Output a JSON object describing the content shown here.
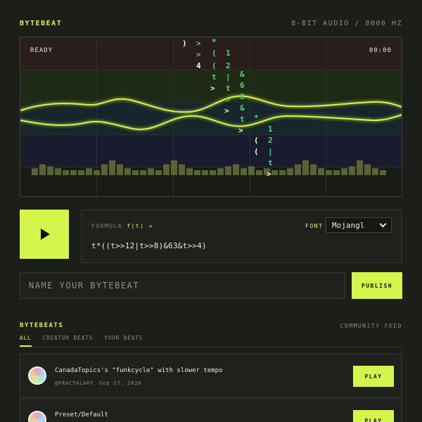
{
  "header": {
    "brand": "BYTEBEAT",
    "spec": "8-BIT AUDIO / 8000 HZ"
  },
  "visualizer": {
    "status": "READY",
    "time": "00:00",
    "bars": [
      0.35,
      0.55,
      0.45,
      0.35,
      0.25,
      0.25,
      0.25,
      0.35,
      0.25,
      0.55,
      0.75,
      0.55,
      0.35,
      0.25,
      0.25,
      0.35,
      0.25,
      0.55,
      0.75,
      0.55,
      0.35,
      0.25,
      0.25,
      0.25,
      0.35,
      0.45,
      0.55,
      0.35,
      0.45,
      0.25,
      0.35,
      0.25,
      0.25,
      0.35,
      0.55,
      0.75,
      0.55,
      0.35,
      0.25,
      0.25,
      0.35,
      0.45,
      0.75,
      0.55,
      0.35,
      0.25
    ],
    "glyphs": [
      {
        "ch": ")",
        "bright": true
      },
      {
        "ch": ">",
        "bright": false
      },
      {
        "ch": "*",
        "bright": false
      },
      {
        "ch": ">",
        "bright": false
      },
      {
        "ch": "(",
        "bright": false
      },
      {
        "ch": "1",
        "bright": false
      },
      {
        "ch": "4",
        "bright": true
      },
      {
        "ch": "(",
        "bright": false
      },
      {
        "ch": "2",
        "bright": false
      },
      {
        "ch": "t",
        "bright": false
      },
      {
        "ch": "|",
        "bright": false
      },
      {
        "ch": "&",
        "bright": false
      },
      {
        "ch": ">",
        "bright": true
      },
      {
        "ch": "t",
        "bright": false
      },
      {
        "ch": "6",
        "bright": false
      },
      {
        "ch": ">",
        "bright": false
      },
      {
        "ch": "3",
        "bright": false
      },
      {
        "ch": ">",
        "bright": true
      },
      {
        "ch": "&",
        "bright": false
      },
      {
        "ch": "t",
        "bright": false
      },
      {
        "ch": "*",
        "bright": false
      },
      {
        "ch": ">",
        "bright": true
      },
      {
        "ch": "1",
        "bright": false
      },
      {
        "ch": "(",
        "bright": true
      },
      {
        "ch": "2",
        "bright": false
      },
      {
        "ch": "(",
        "bright": true
      },
      {
        "ch": "|",
        "bright": false
      },
      {
        "ch": "t",
        "bright": false
      },
      {
        "ch": ">",
        "bright": true
      }
    ]
  },
  "controls": {
    "formula_label": "FORMULA",
    "fx_label": "f(t) =",
    "font_label": "FONT",
    "font_value": "Mojangl",
    "formula": "t*((t>>12|t>>8)&63&t>>4)"
  },
  "publish": {
    "placeholder": "NAME YOUR BYTEBEAT",
    "button": "PUBLISH"
  },
  "feed": {
    "title": "BYTEBEATS",
    "community": "COMMUNITY FEED",
    "tabs": [
      "ALL",
      "CREATOR BEATS",
      "YOUR BEATS"
    ],
    "items": [
      {
        "title": "CanadaTopics's \"funkcycle\" with slower tempo",
        "handle": "@FRACTALART",
        "date": "Sep 27, 2026",
        "play": "PLAY"
      },
      {
        "title": "Preset/Default",
        "handle": "",
        "date": "",
        "play": "PLAY"
      }
    ]
  },
  "colors": {
    "accent": "#d6f54a",
    "wave": "#d6f54a",
    "glyph": "#4fd47a"
  }
}
